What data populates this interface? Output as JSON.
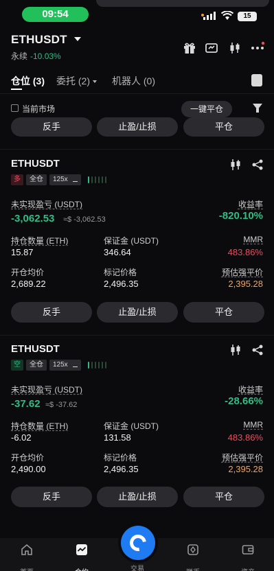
{
  "status_bar": {
    "time": "09:54",
    "battery": "15"
  },
  "header": {
    "symbol": "ETHUSDT",
    "contract_type": "永续",
    "change": "-10.03%",
    "icons": [
      "gift-icon",
      "card-icon",
      "candlestick-icon",
      "more-icon"
    ]
  },
  "tabs": [
    {
      "label": "仓位 (3)",
      "active": true
    },
    {
      "label": "委托 (2)",
      "active": false
    },
    {
      "label": "机器人 (0)",
      "active": false
    }
  ],
  "filter": {
    "current_market_label": "当前市场",
    "close_all_label": "一键平仓"
  },
  "top_buttons": {
    "reverse": "反手",
    "tpsl": "止盈/止损",
    "close": "平仓"
  },
  "positions": [
    {
      "symbol": "ETHUSDT",
      "side": "多",
      "margin_mode": "全仓",
      "leverage": "125x",
      "unrealized_pnl_label": "未实现盈亏 (USDT)",
      "unrealized_pnl": "-3,062.53",
      "unrealized_pnl_usd": "≈$ -3,062.53",
      "roe_label": "收益率",
      "roe": "-820.10%",
      "size_label": "持仓数量 (ETH)",
      "size": "15.87",
      "margin_label": "保证金 (USDT)",
      "margin": "346.64",
      "mmr_label": "MMR",
      "mmr": "483.86%",
      "entry_label": "开仓均价",
      "entry": "2,689.22",
      "mark_label": "标记价格",
      "mark": "2,496.35",
      "liq_label": "预估强平价",
      "liq": "2,395.28",
      "buttons": {
        "reverse": "反手",
        "tpsl": "止盈/止损",
        "close": "平仓"
      }
    },
    {
      "symbol": "ETHUSDT",
      "side": "空",
      "margin_mode": "全仓",
      "leverage": "125x",
      "unrealized_pnl_label": "未实现盈亏 (USDT)",
      "unrealized_pnl": "-37.62",
      "unrealized_pnl_usd": "≈$ -37.62",
      "roe_label": "收益率",
      "roe": "-28.66%",
      "size_label": "持仓数量 (ETH)",
      "size": "-6.02",
      "margin_label": "保证金 (USDT)",
      "margin": "131.58",
      "mmr_label": "MMR",
      "mmr": "483.86%",
      "entry_label": "开仓均价",
      "entry": "2,490.00",
      "mark_label": "标记价格",
      "mark": "2,496.35",
      "liq_label": "预估强平价",
      "liq": "2,395.28",
      "buttons": {
        "reverse": "反手",
        "tpsl": "止盈/止损",
        "close": "平仓"
      }
    }
  ],
  "bottom_nav": [
    {
      "label": "首页",
      "icon": "home-icon"
    },
    {
      "label": "合约",
      "icon": "chart-icon",
      "active": true
    },
    {
      "label": "交易",
      "icon": "trade-icon"
    },
    {
      "label": "赚币",
      "icon": "earn-icon"
    },
    {
      "label": "资产",
      "icon": "wallet-icon"
    }
  ],
  "colors": {
    "green": "#2ebd85",
    "red": "#f04a5b",
    "orange": "#f5a35b",
    "accent_blue": "#1f7bf2"
  }
}
